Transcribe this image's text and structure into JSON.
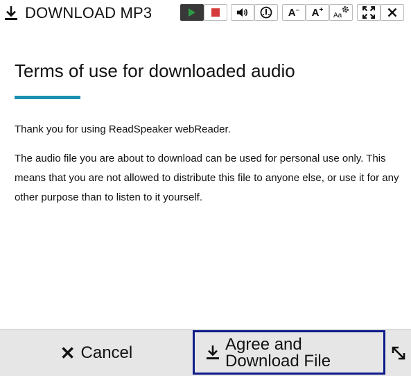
{
  "toolbar": {
    "title": "DOWNLOAD MP3",
    "title_icon": "download-icon",
    "buttons": [
      {
        "name": "play",
        "icon": "play-icon",
        "color": "#2e9a46"
      },
      {
        "name": "stop",
        "icon": "stop-icon",
        "color": "#d43a3a"
      },
      {
        "name": "volume",
        "icon": "speaker-icon"
      },
      {
        "name": "speed",
        "icon": "speed-gauge-icon"
      },
      {
        "name": "decrease-font",
        "icon": "font-decrease-icon",
        "label": "A",
        "suffix": "–"
      },
      {
        "name": "increase-font",
        "icon": "font-increase-icon",
        "label": "A",
        "suffix": "+"
      },
      {
        "name": "text-settings",
        "icon": "text-settings-icon",
        "label": "Aa"
      },
      {
        "name": "fullscreen",
        "icon": "expand-icon"
      },
      {
        "name": "close",
        "icon": "close-icon"
      }
    ]
  },
  "content": {
    "heading": "Terms of use for downloaded audio",
    "accent_color": "#1a8fb0",
    "paragraph1": "Thank you for using ReadSpeaker webReader.",
    "paragraph2": "The audio file you are about to download can be used for personal use only. This means that you are not allowed to distribute this file to anyone else, or use it for any other purpose than to listen to it yourself."
  },
  "footer": {
    "cancel": {
      "icon": "close-x-icon",
      "label": "Cancel"
    },
    "agree": {
      "icon": "download-icon",
      "label": "Agree and\nDownload File",
      "border_color": "#0c1a8a"
    },
    "resize": {
      "icon": "resize-diagonal-icon"
    }
  }
}
